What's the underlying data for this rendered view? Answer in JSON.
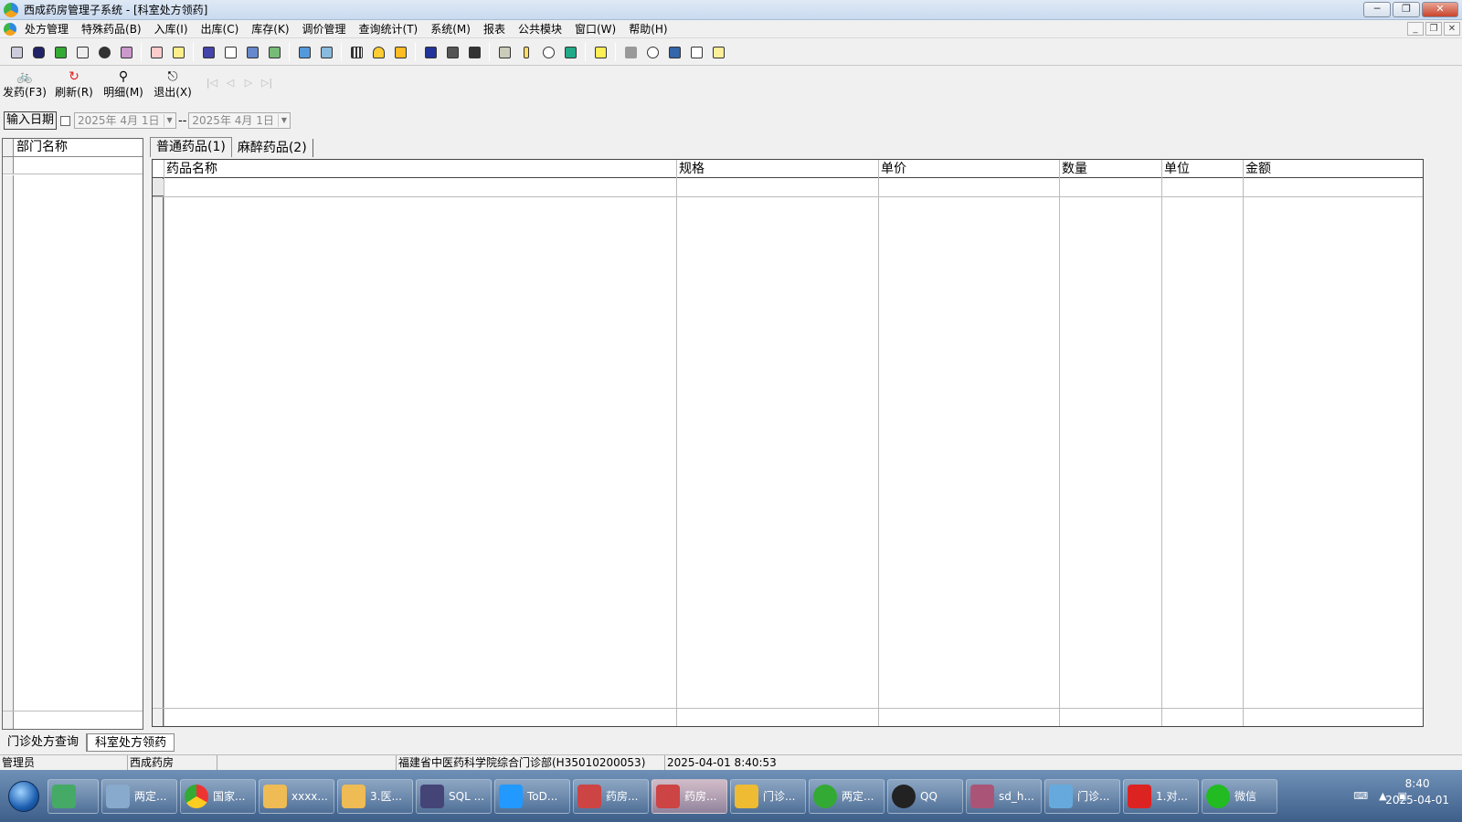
{
  "window": {
    "title": "西成药房管理子系统 - [科室处方领药]"
  },
  "menu": [
    "处方管理",
    "特殊药品(B)",
    "入库(I)",
    "出库(C)",
    "库存(K)",
    "调价管理",
    "查询统计(T)",
    "系统(M)",
    "报表",
    "公共模块",
    "窗口(W)",
    "帮助(H)"
  ],
  "actions": [
    {
      "label": "发药(F3)",
      "icon": "dispense-icon"
    },
    {
      "label": "刷新(R)",
      "icon": "refresh-icon"
    },
    {
      "label": "明细(M)",
      "icon": "detail-icon"
    },
    {
      "label": "退出(X)",
      "icon": "exit-icon"
    }
  ],
  "filter": {
    "label": "输入日期",
    "date_from": "2025年 4月 1日",
    "sep": "--",
    "date_to": "2025年 4月 1日"
  },
  "left_panel": {
    "header": "部门名称"
  },
  "tabs": [
    "普通药品(1)",
    "麻醉药品(2)"
  ],
  "table": {
    "columns": [
      "药品名称",
      "规格",
      "单价",
      "数量",
      "单位",
      "金额"
    ]
  },
  "bottom_tabs": [
    "门诊处方查询",
    "科室处方领药"
  ],
  "status": {
    "user": "管理员",
    "dept": "西成药房",
    "blank": "",
    "org": "福建省中医药科学院综合门诊部(H35010200053)",
    "datetime": "2025-04-01 8:40:53"
  },
  "taskbar": {
    "items": [
      {
        "label": "",
        "color": "#4a6"
      },
      {
        "label": "两定...",
        "color": "#8ac"
      },
      {
        "label": "国家...",
        "color": "#e33"
      },
      {
        "label": "xxxx...",
        "color": "#eb5"
      },
      {
        "label": "3.医...",
        "color": "#eb5"
      },
      {
        "label": "SQL ...",
        "color": "#447"
      },
      {
        "label": "ToD...",
        "color": "#29f"
      },
      {
        "label": "药房...",
        "color": "#c44"
      },
      {
        "label": "药房...",
        "color": "#c44"
      },
      {
        "label": "门诊...",
        "color": "#eb3"
      },
      {
        "label": "两定...",
        "color": "#3a3"
      },
      {
        "label": "QQ",
        "color": "#222"
      },
      {
        "label": "sd_h...",
        "color": "#a57"
      },
      {
        "label": "门诊...",
        "color": "#6ad"
      },
      {
        "label": "1.对...",
        "color": "#d22"
      },
      {
        "label": "微信",
        "color": "#2b2"
      }
    ],
    "time": "8:40",
    "date": "2025-04-01"
  }
}
